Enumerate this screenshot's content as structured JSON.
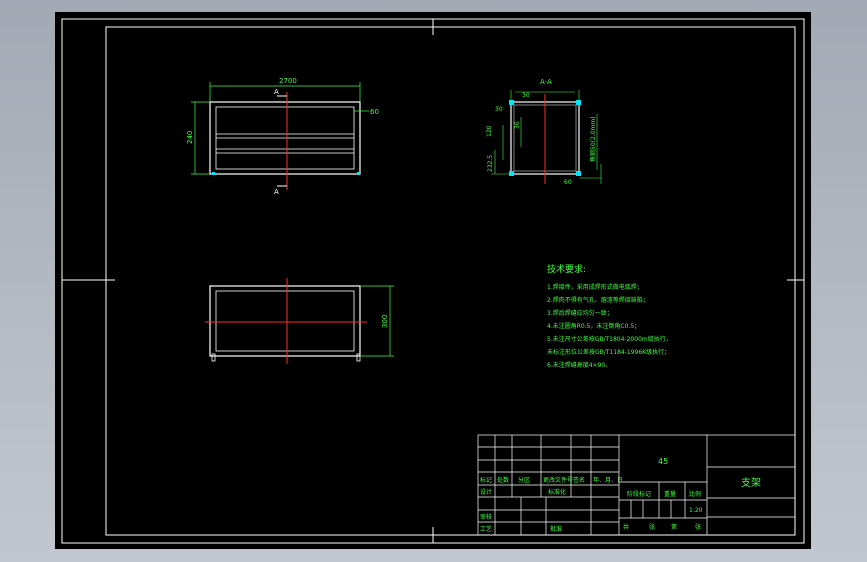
{
  "drawing": {
    "front_view": {
      "width_dim": "2700",
      "height_dim": "240",
      "section_mark_top": "A",
      "section_mark_bottom": "A",
      "right_callout": "60"
    },
    "top_view": {
      "depth_dim": "300"
    },
    "section_view": {
      "title": "A-A",
      "dim_top_left": "30",
      "dim_top_right": "30",
      "dim_inner": "120",
      "dim_inner2": "30",
      "dim_left": "232.5",
      "dim_right": "60",
      "dim_side_vertical": "角钢50(2.0mm)"
    },
    "tech_requirements": {
      "title": "技术要求:",
      "items": [
        "1.焊接件，采用成焊形式做电弧焊；",
        "2.焊肉不得有气孔、熔渣等焊接缺陷；",
        "3.焊后焊缝应均匀一致；",
        "4.未注圆角R0.5，未注倒角C0.5；",
        "5.未注尺寸公差按GB/T1804-2000m级执行，",
        "  未标注形位公差按GB/T1184-1996K级执行；",
        "6.未注焊缝高度4×90。"
      ]
    },
    "title_block": {
      "material": "45",
      "part_name": "支架",
      "header_row": [
        "标记",
        "处数",
        "分区",
        "更改文件号",
        "签名",
        "年、月、日"
      ],
      "row_designer": "设计",
      "row_standard": "标准化",
      "row_check": "审核",
      "row_process": "工艺",
      "row_approve": "批准",
      "stage_mark": "阶段标记",
      "weight": "重量",
      "scale": "比例",
      "scale_value": "1:20",
      "total_label": "共",
      "sheet_label": "张",
      "page_label": "第",
      "page_suffix": "张"
    }
  }
}
